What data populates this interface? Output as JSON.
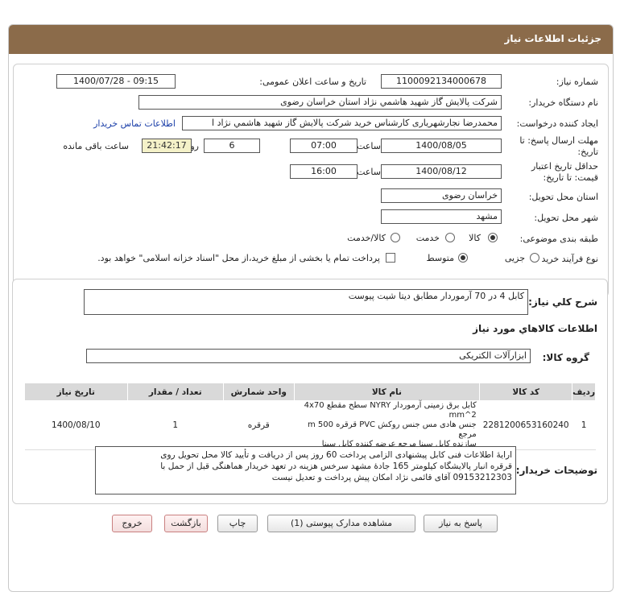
{
  "header": {
    "title": "جزئیات اطلاعات نیاز"
  },
  "form": {
    "need_number": {
      "label": "شماره نیاز:",
      "value": "1100092134000678"
    },
    "announce_datetime": {
      "label": "تاریخ و ساعت اعلان عمومی:",
      "value": "1400/07/28 - 09:15"
    },
    "buyer_org": {
      "label": "نام دستگاه خریدار:",
      "value": "شرکت پالایش گاز شهید هاشمي نژاد   استان خراسان رضوی"
    },
    "requester": {
      "label": "ایجاد کننده درخواست:",
      "value": "محمدرضا نجارشهریاری کارشناس خرید شرکت پالایش گاز شهید هاشمي نژاد   ا",
      "contact_link": "اطلاعات تماس خریدار"
    },
    "reply_deadline": {
      "label_line1": "مهلت ارسال پاسخ: تا",
      "label_line2": "تاریخ:",
      "date": "1400/08/05",
      "time_label": "ساعت",
      "time": "07:00",
      "days": "6",
      "days_label": "روز و",
      "remaining": "21:42:17",
      "remaining_label": "ساعت باقی مانده"
    },
    "price_validity": {
      "label_line1": "حداقل تاریخ اعتبار",
      "label_line2": "قیمت: تا تاریخ:",
      "date": "1400/08/12",
      "time_label": "ساعت",
      "time": "16:00"
    },
    "delivery_province": {
      "label": "استان محل تحویل:",
      "value": "خراسان رضوی"
    },
    "delivery_city": {
      "label": "شهر محل تحویل:",
      "value": "مشهد"
    },
    "category": {
      "label": "طبقه بندی موضوعی:",
      "options": [
        "کالا",
        "خدمت",
        "کالا/خدمت"
      ],
      "selected": "کالا"
    },
    "purchase_process": {
      "label": "نوع فرآیند خرید :",
      "options": [
        "جزیی",
        "متوسط"
      ],
      "selected": "متوسط",
      "payment_note": "پرداخت تمام یا بخشی از مبلغ خرید،از محل \"اسناد خزانه اسلامی\" خواهد بود."
    }
  },
  "summary": {
    "label": "شرح کلي نياز:",
    "value": "کابل 4 در 70 آرموردار مطابق دیتا شیت پیوست"
  },
  "goods_section": {
    "title": "اطلاعات کالاهاي مورد نياز",
    "group_label": "گروه کالا:",
    "group_value": "ابزارآلات الکتریکی",
    "columns": [
      "ردیف",
      "کد کالا",
      "نام کالا",
      "واحد شمارش",
      "تعداد / مقدار",
      "تاریخ نیاز"
    ],
    "rows": [
      {
        "row": "1",
        "code": "2281200653160240",
        "name_line1": "کابل برق زمینی آرموردار NYRY سطح مقطع 4x70 mm^2",
        "name_line2": "جنس هادی مس جنس روکش PVC قرقره 500 m مرجع",
        "name_line3": "سازنده کابل سینا مرجع عرضه کننده کابل سینا",
        "unit": "قرقره",
        "qty": "1",
        "date": "1400/08/10"
      }
    ]
  },
  "buyer_notes": {
    "label": "توضیحات خریدار:",
    "line1": "ارایهٔ اطلاعات فنی کابل پیشنهادی الزامی پرداخت 60 روز پس از دریافت و تأیید کالا محل تحویل روی",
    "line2": "قرقره انبار پالایشگاه کیلومتر 165 جادهٔ مشهد سرخس هزینه در تعهد خریدار هماهنگی قبل از حمل با",
    "line3": "09153212303 آقای قائمی نژاد امکان پیش پرداخت و تعدیل نیست"
  },
  "buttons": {
    "reply": "پاسخ به نیاز",
    "attachments": "مشاهده مدارک پیوستی (1)",
    "print": "چاپ",
    "back": "بازگشت",
    "exit": "خروج"
  }
}
